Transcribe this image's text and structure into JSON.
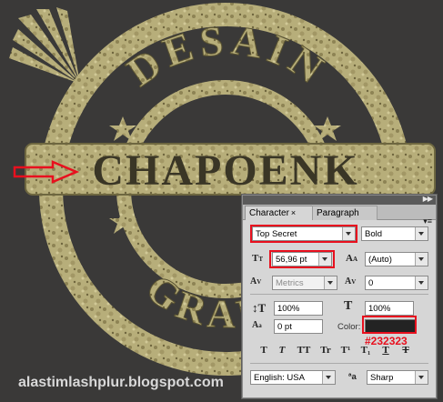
{
  "artwork": {
    "top_text": "DESAIN",
    "center_text": "CHAPOENK",
    "bottom_text": "GRAFIS"
  },
  "watermark": "alastimlashplur.blogspot.com",
  "panel": {
    "tabs": [
      {
        "label": "Character",
        "close": "×",
        "active": true
      },
      {
        "label": "Paragraph",
        "active": false
      }
    ],
    "collapse_icon": "double-arrow-icon",
    "menu_icon": "panel-menu-icon",
    "font_family": "Top Secret",
    "font_style": "Bold",
    "font_size": "56,96 pt",
    "leading": "(Auto)",
    "kerning": "Metrics",
    "tracking": "0",
    "vertical_scale": "100%",
    "horizontal_scale": "100%",
    "baseline_shift": "0 pt",
    "color_label": "Color:",
    "color_value": "#232323",
    "style_buttons": [
      "T",
      "T",
      "TT",
      "Tr",
      "T¹",
      "T₁",
      "T",
      "T"
    ],
    "language": "English: USA",
    "antialias_label": "ªa",
    "antialias": "Sharp"
  },
  "annotation_color": "#e8101e"
}
